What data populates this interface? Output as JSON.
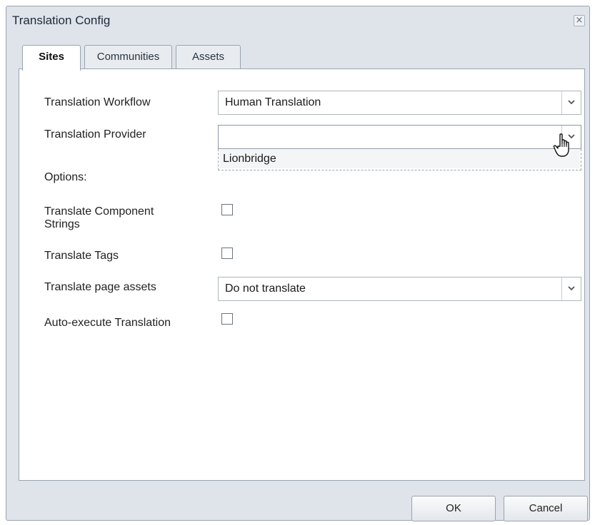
{
  "dialog": {
    "title": "Translation Config",
    "close_glyph": "×"
  },
  "tabs": [
    {
      "label": "Sites",
      "active": true
    },
    {
      "label": "Communities",
      "active": false
    },
    {
      "label": "Assets",
      "active": false
    }
  ],
  "form": {
    "workflow": {
      "label": "Translation Workflow",
      "value": "Human Translation"
    },
    "provider": {
      "label": "Translation Provider",
      "value": "",
      "options": [
        "Lionbridge"
      ]
    },
    "options_label": "Options:",
    "component_strings": {
      "label_line1": "Translate Component",
      "label_line2": "Strings",
      "checked": false
    },
    "tags": {
      "label": "Translate Tags",
      "checked": false
    },
    "page_assets": {
      "label": "Translate page assets",
      "value": "Do not translate"
    },
    "auto_execute": {
      "label": "Auto-execute Translation",
      "checked": false
    }
  },
  "footer": {
    "ok_label": "OK",
    "cancel_label": "Cancel"
  },
  "icons": {
    "dropdown_arrow": "chevron-down-icon",
    "cursor": "hand-pointer-icon"
  }
}
